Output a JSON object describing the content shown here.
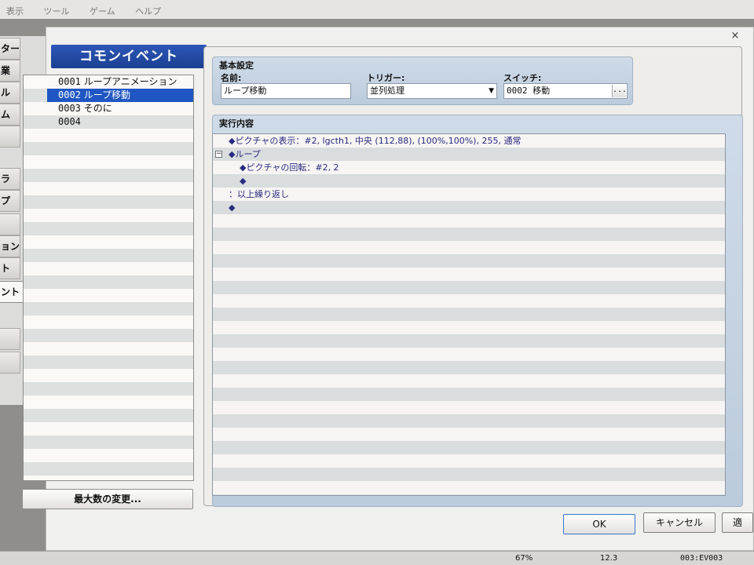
{
  "menubar": {
    "items": [
      "表示",
      "ツール",
      "ゲーム",
      "ヘルプ"
    ]
  },
  "left_tabs": [
    "ター",
    "業",
    "ル",
    "ム",
    "",
    "ラ",
    "プ",
    "",
    "ョン",
    "ト",
    "ント",
    "",
    ""
  ],
  "dialog": {
    "close": "×"
  },
  "list": {
    "title": "コモンイベント",
    "rows": [
      {
        "id": "0001",
        "name": "ループアニメーション"
      },
      {
        "id": "0002",
        "name": "ループ移動"
      },
      {
        "id": "0003",
        "name": "そのに"
      },
      {
        "id": "0004",
        "name": ""
      }
    ],
    "selected_index": 1,
    "max_button": "最大数の変更..."
  },
  "basic": {
    "group_title": "基本設定",
    "name_label": "名前:",
    "name_value": "ループ移動",
    "trigger_label": "トリガー:",
    "trigger_value": "並列処理",
    "switch_label": "スイッチ:",
    "switch_value": "0002 移動",
    "switch_button": "..."
  },
  "contents": {
    "group_title": "実行内容",
    "lines": [
      {
        "indent": 0,
        "text": "◆ピクチャの表示：#2, lgcth1, 中央 (112,88), (100%,100%), 255, 通常"
      },
      {
        "indent": 0,
        "text": "◆ループ"
      },
      {
        "indent": 1,
        "text": "◆ピクチャの回転：#2, 2"
      },
      {
        "indent": 1,
        "text": "◆"
      },
      {
        "indent": 0,
        "text": "：以上繰り返し"
      },
      {
        "indent": 0,
        "text": "◆"
      }
    ]
  },
  "buttons": {
    "ok": "OK",
    "cancel": "キャンセル",
    "apply": "適"
  },
  "status": {
    "zoom": "67%",
    "value": "12.3",
    "event": "003:EV003"
  },
  "colors": {
    "title_blue": "#1f4ca8",
    "selection": "#1f56c3",
    "group_bg": "#c6d4e3"
  }
}
